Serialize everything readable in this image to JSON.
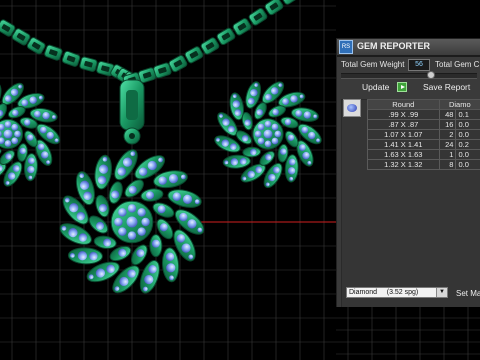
{
  "panel": {
    "title": "GEM REPORTER",
    "logo_text": "RS",
    "total_weight_label": "Total Gem Weight",
    "total_weight_value": "56",
    "total_count_label": "Total Gem C",
    "update_label": "Update",
    "save_report_label": "Save Report",
    "material_select": "Diamond     (3.52 spg)",
    "set_material_label": "Set Ma"
  },
  "table": {
    "headers": [
      "Round",
      "Diamo"
    ],
    "rows": [
      {
        "size": ".99 X .99",
        "count": "48",
        "weight": "0.1"
      },
      {
        "size": ".87 X .87",
        "count": "16",
        "weight": "0.0"
      },
      {
        "size": "1.07 X 1.07",
        "count": "2",
        "weight": "0.0"
      },
      {
        "size": "1.41 X 1.41",
        "count": "24",
        "weight": "0.2"
      },
      {
        "size": "1.63 X 1.63",
        "count": "1",
        "weight": "0.0"
      },
      {
        "size": "1.32 X 1.32",
        "count": "8",
        "weight": "0.0"
      }
    ]
  },
  "colors": {
    "metal": "#1fa36c",
    "gem": "#7fa6f5",
    "background": "#000000",
    "grid": "#3a3a3a",
    "axis": "#d02020"
  },
  "icons": {
    "logo": "rhino-logo-icon",
    "play": "play-icon",
    "gem": "gem-icon",
    "dropdown": "chevron-down-icon"
  }
}
